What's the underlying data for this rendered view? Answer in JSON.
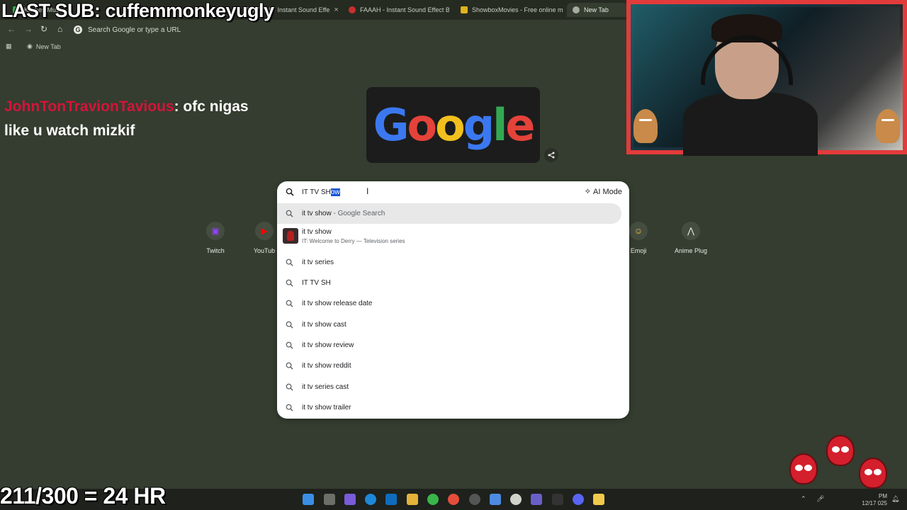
{
  "tabs": [
    {
      "label": "Kitchen Music",
      "color": "#3aa655"
    },
    {
      "label": "Bool Bell - Instant Sound Effe",
      "color": "#c9302c"
    },
    {
      "label": "FAAAH - Instant Sound Effect B",
      "color": "#c9302c"
    },
    {
      "label": "ShowboxMovies - Free online m",
      "color": "#e0b21c"
    },
    {
      "label": "New Tab",
      "color": "#a6aca0"
    }
  ],
  "toolbar": {
    "omnibox_placeholder": "Search Google or type a URL"
  },
  "bookmarks": {
    "new_tab": "New Tab"
  },
  "overlay": {
    "last_sub": "LAST SUB: cuffemmonkeyugly",
    "chat_user": "JohnTonTravionTavious",
    "chat_text": ": ofc nigas like u watch mizkif",
    "sub_count": "211/300 = 24 HR"
  },
  "doodle": {
    "letters": [
      "G",
      "o",
      "o",
      "g",
      "l",
      "e"
    ]
  },
  "shortcuts": [
    {
      "label": "Twitch",
      "icon": "twitch-icon",
      "color": "#9146ff"
    },
    {
      "label": "YouTub",
      "icon": "youtube-icon",
      "color": "#ff0000"
    },
    {
      "label": "Emoji",
      "icon": "emoji-icon",
      "color": "#f5c342"
    },
    {
      "label": "Anime Plug",
      "icon": "anime-plug-icon",
      "color": "#e8eae3"
    }
  ],
  "search": {
    "query_typed": "IT TV SH",
    "query_autocomplete": "ow",
    "ai_mode_label": "AI Mode",
    "suggestions": [
      {
        "text": "it tv show",
        "suffix": " - Google Search"
      },
      {
        "text": "it tv show",
        "subtitle": "IT: Welcome to Derry — Television series"
      },
      {
        "text": "it tv series"
      },
      {
        "text": "IT TV SH"
      },
      {
        "text": "it tv show release date"
      },
      {
        "text": "it tv show cast"
      },
      {
        "text": "it tv show review"
      },
      {
        "text": "it tv show reddit"
      },
      {
        "text": "it tv series cast"
      },
      {
        "text": "it tv show trailer"
      }
    ]
  },
  "taskbar": {
    "clock_time": "PM",
    "clock_date": "12/17 025"
  }
}
